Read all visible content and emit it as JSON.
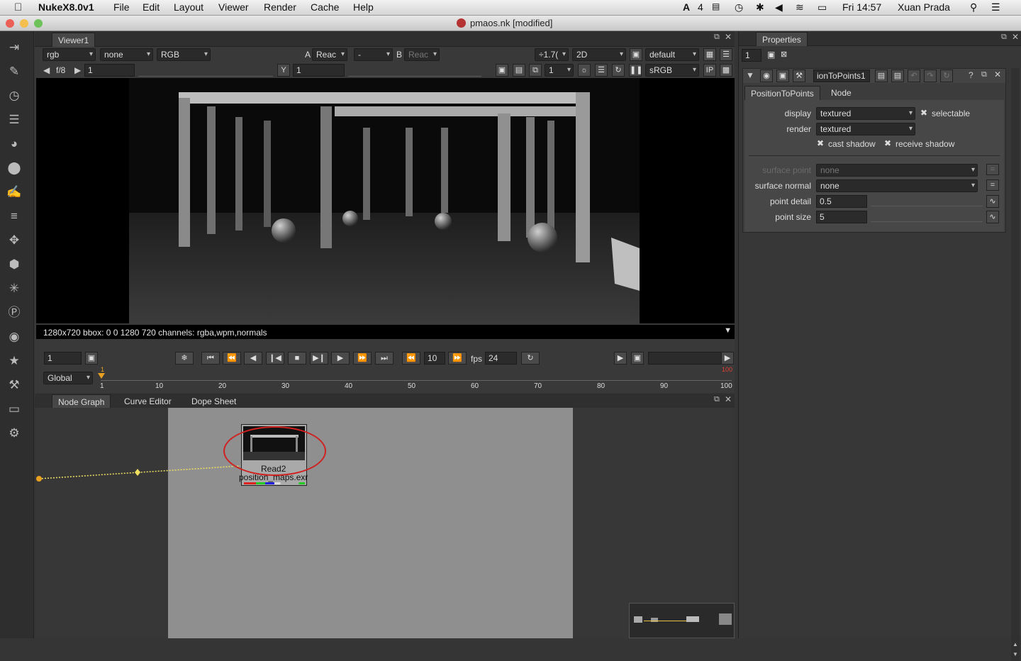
{
  "menubar": {
    "app": "NukeX8.0v1",
    "items": [
      "File",
      "Edit",
      "Layout",
      "Viewer",
      "Render",
      "Cache",
      "Help"
    ],
    "status_adobe_count": "4",
    "clock": "Fri 14:57",
    "user": "Xuan Prada"
  },
  "window": {
    "title": "pmaos.nk [modified]"
  },
  "viewer": {
    "tab": "Viewer1",
    "channels": "rgb",
    "alpha": "none",
    "colorspace": "RGB",
    "a_label": "A",
    "a_input": "Reac",
    "dash": "-",
    "b_label": "B",
    "b_input": "Reac",
    "zoom": "÷1.7(",
    "mode": "2D",
    "lut": "default",
    "fstop": "f/8",
    "gain": "1",
    "y_label": "Y",
    "gamma": "1",
    "proxy": "1",
    "view_lut": "sRGB",
    "ip": "IP",
    "info": "1280x720 bbox: 0 0 1280 720 channels: rgba,wpm,normals"
  },
  "timeline": {
    "frame": "1",
    "increment": "10",
    "fps_label": "fps",
    "fps": "24",
    "range": "Global",
    "ticks": [
      "1",
      "10",
      "20",
      "30",
      "40",
      "50",
      "60",
      "70",
      "80",
      "90",
      "100"
    ],
    "start_marker": "1",
    "end_marker": "100"
  },
  "nodegraph": {
    "tabs": [
      "Node Graph",
      "Curve Editor",
      "Dope Sheet"
    ],
    "node_name": "Read2",
    "node_file": "position_maps.exr"
  },
  "properties": {
    "title": "Properties",
    "max_panels": "1",
    "node_name": "ionToPoints1",
    "tabs": [
      "PositionToPoints",
      "Node"
    ],
    "display_label": "display",
    "display_value": "textured",
    "selectable_label": "selectable",
    "render_label": "render",
    "render_value": "textured",
    "cast_shadow_label": "cast shadow",
    "receive_shadow_label": "receive shadow",
    "surface_point_label": "surface point",
    "surface_point_value": "none",
    "surface_normal_label": "surface normal",
    "surface_normal_value": "none",
    "point_detail_label": "point detail",
    "point_detail_value": "0.5",
    "point_size_label": "point size",
    "point_size_value": "5",
    "eq": "="
  },
  "colors": {
    "accent_orange": "#e8a020",
    "link_yellow": "#f0e060",
    "circle_red": "#d02020"
  }
}
